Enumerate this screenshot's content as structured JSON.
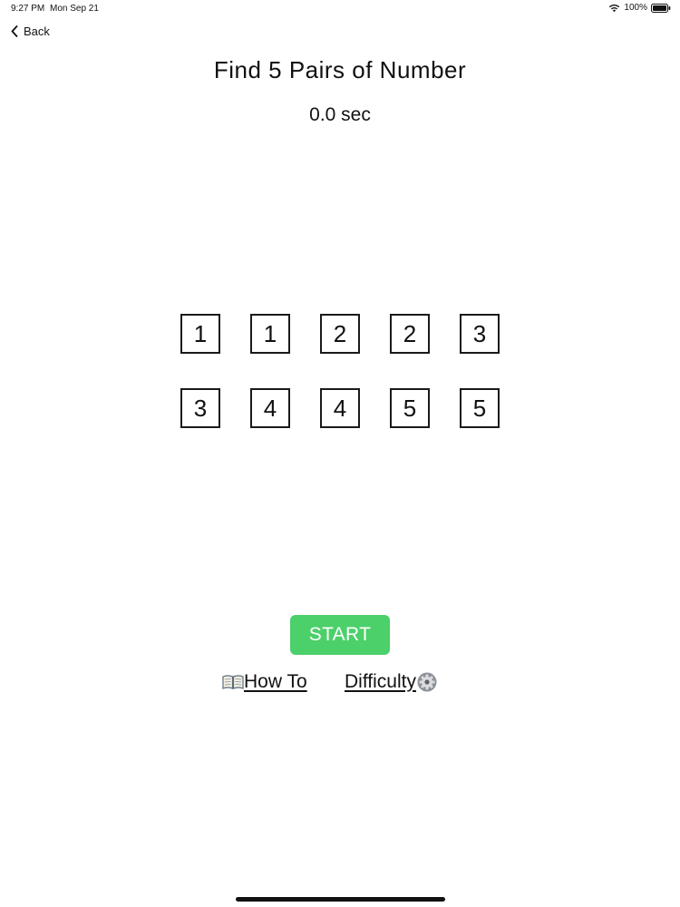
{
  "status_bar": {
    "time": "9:27 PM",
    "date": "Mon Sep 21",
    "battery": "100%"
  },
  "nav": {
    "back_label": "Back"
  },
  "game": {
    "title": "Find 5 Pairs of Number",
    "timer": "0.0 sec",
    "tiles": [
      "1",
      "1",
      "2",
      "2",
      "3",
      "3",
      "4",
      "4",
      "5",
      "5"
    ]
  },
  "actions": {
    "start_label": "START",
    "howto_label": "How To",
    "difficulty_label": "Difficulty"
  },
  "colors": {
    "start_button": "#4cd06a"
  }
}
